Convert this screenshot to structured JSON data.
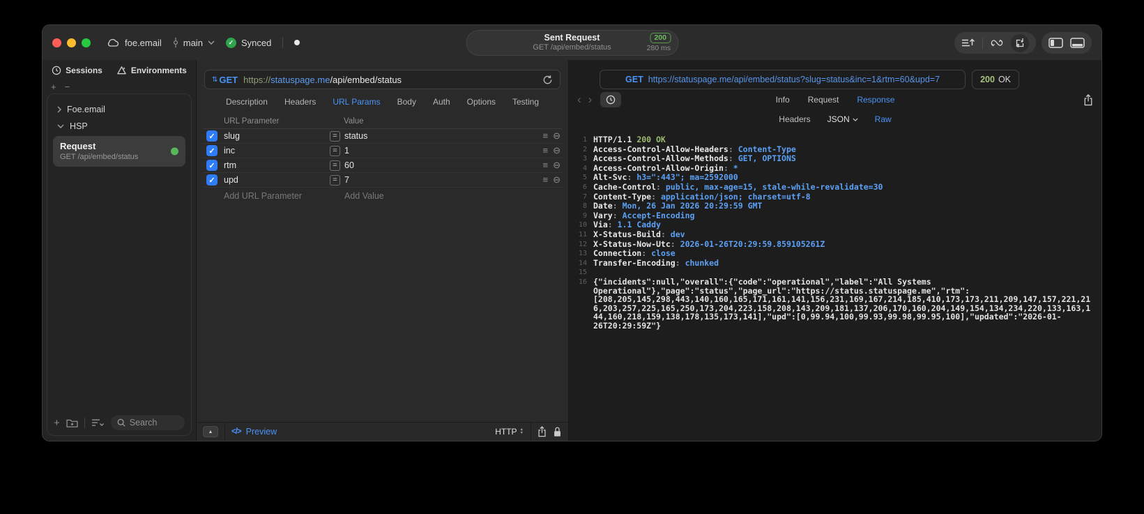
{
  "titlebar": {
    "project": "foe.email",
    "branch": "main",
    "sync_label": "Synced",
    "session_pill": {
      "title": "Sent Request",
      "subtitle": "GET /api/embed/status",
      "status_code": "200",
      "duration": "280 ms"
    }
  },
  "sidebar": {
    "tabs": {
      "sessions": "Sessions",
      "environments": "Environments"
    },
    "tree": {
      "group1": "Foe.email",
      "group2": "HSP"
    },
    "request_item": {
      "title": "Request",
      "subtitle": "GET /api/embed/status"
    },
    "search_placeholder": "Search"
  },
  "request_pane": {
    "method": "GET",
    "url": {
      "scheme": "https://",
      "host": "statuspage.me",
      "path": "/api/embed/status"
    },
    "tabs": [
      "Description",
      "Headers",
      "URL Params",
      "Body",
      "Auth",
      "Options",
      "Testing"
    ],
    "active_tab": "URL Params",
    "params": {
      "col_name": "URL Parameter",
      "col_value": "Value",
      "rows": [
        {
          "name": "slug",
          "value": "status",
          "enabled": true
        },
        {
          "name": "inc",
          "value": "1",
          "enabled": true
        },
        {
          "name": "rtm",
          "value": "60",
          "enabled": true
        },
        {
          "name": "upd",
          "value": "7",
          "enabled": true
        }
      ],
      "add_name": "Add URL Parameter",
      "add_value": "Add Value"
    },
    "footer": {
      "preview": "Preview",
      "protocol": "HTTP"
    }
  },
  "response_pane": {
    "method": "GET",
    "url": "https://statuspage.me/api/embed/status?slug=status&inc=1&rtm=60&upd=7",
    "status_code": "200",
    "status_text": "OK",
    "tabs": [
      "Info",
      "Request",
      "Response"
    ],
    "active_tab": "Response",
    "view_tabs": {
      "headers": "Headers",
      "format": "JSON",
      "raw": "Raw"
    },
    "active_view": "Raw",
    "response_text": {
      "status_line": {
        "protocol": "HTTP/1.1",
        "status": "200 OK"
      },
      "headers": [
        {
          "name": "Access-Control-Allow-Headers",
          "value": "Content-Type"
        },
        {
          "name": "Access-Control-Allow-Methods",
          "value": "GET, OPTIONS"
        },
        {
          "name": "Access-Control-Allow-Origin",
          "value": "*"
        },
        {
          "name": "Alt-Svc",
          "value": "h3=\":443\"; ma=2592000"
        },
        {
          "name": "Cache-Control",
          "value": "public, max-age=15, stale-while-revalidate=30"
        },
        {
          "name": "Content-Type",
          "value": "application/json; charset=utf-8"
        },
        {
          "name": "Date",
          "value": "Mon, 26 Jan 2026 20:29:59 GMT"
        },
        {
          "name": "Vary",
          "value": "Accept-Encoding"
        },
        {
          "name": "Via",
          "value": "1.1 Caddy"
        },
        {
          "name": "X-Status-Build",
          "value": "dev"
        },
        {
          "name": "X-Status-Now-Utc",
          "value": "2026-01-26T20:29:59.859105261Z"
        },
        {
          "name": "Connection",
          "value": "close"
        },
        {
          "name": "Transfer-Encoding",
          "value": "chunked"
        }
      ],
      "body": "{\"incidents\":null,\"overall\":{\"code\":\"operational\",\"label\":\"All Systems Operational\"},\"page\":\"status\",\"page_url\":\"https://status.statuspage.me\",\"rtm\":[208,205,145,298,443,140,160,165,171,161,141,156,231,169,167,214,185,410,173,173,211,209,147,157,221,216,203,257,225,165,250,173,204,223,158,208,143,209,181,137,206,170,160,204,149,154,134,234,220,133,163,144,160,218,159,138,178,135,173,141],\"upd\":[0,99.94,100,99.93,99.98,99.95,100],\"updated\":\"2026-01-26T20:29:59Z\"}"
    }
  },
  "icons": {
    "method_selector": "⇅",
    "row_drag": "≡",
    "row_remove": "⊖",
    "collapse_panel": "▲",
    "code_preview": "</>",
    "back": "‹",
    "forward": "›",
    "plus": "+",
    "minus": "−",
    "check": "✓"
  },
  "colors": {
    "accent_blue": "#4b93f7",
    "status_green": "#6dbd5f",
    "checkbox_blue": "#2e7cf6"
  }
}
